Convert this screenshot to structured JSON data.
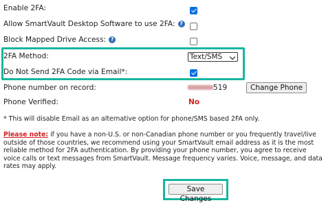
{
  "rows": {
    "enable_2fa": {
      "label": "Enable 2FA:",
      "checked": true
    },
    "allow_desktop": {
      "label": "Allow SmartVault Desktop Software to use 2FA:",
      "checked": false
    },
    "block_drive": {
      "label": "Block Mapped Drive Access:",
      "checked": false
    },
    "method": {
      "label": "2FA Method:",
      "value": "Text/SMS"
    },
    "no_email": {
      "label": "Do Not Send 2FA Code via Email*:",
      "checked": true
    },
    "phone": {
      "label": "Phone number on record:",
      "suffix": "519",
      "button": "Change Phone"
    },
    "verified": {
      "label": "Phone Verified:",
      "value": "No"
    }
  },
  "help_icon": "?",
  "footnote": "* This will disable Email as an alternative option for phone/SMS based 2FA only.",
  "notice": {
    "lead": "Please note:",
    "body": " if you have a non-U.S. or non-Canadian phone number or you frequently travel/live outside of those countries, we recommend using your SmartVault email address as it is the most reliable method for 2FA authentication. By providing your phone number, you agree to receive voice calls or text messages from SmartVault. Message frequency varies. Voice, message, and data rates may apply."
  },
  "save_label": "Save Changes",
  "colors": {
    "highlight": "#16b6a0",
    "checkbox": "#0b6fe0",
    "alert": "#d31f1f"
  }
}
